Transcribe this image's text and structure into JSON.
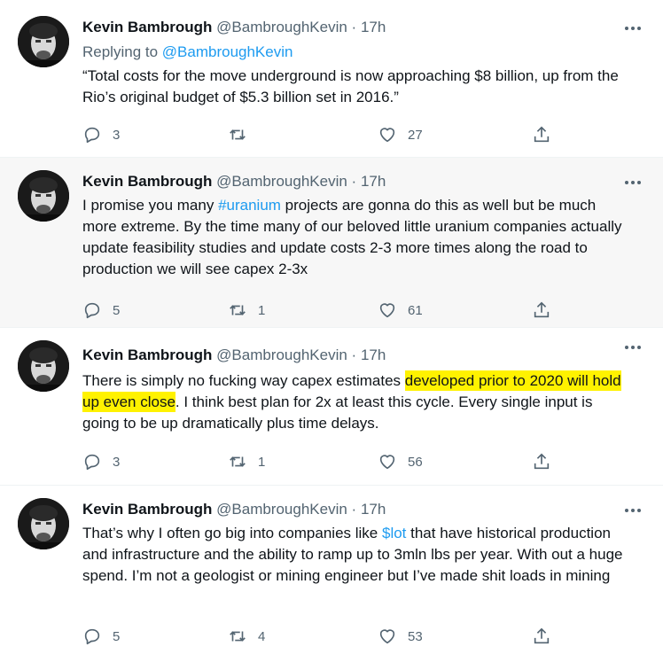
{
  "tweets": [
    {
      "name": "Kevin Bambrough",
      "handle": "@BambroughKevin",
      "separator": "·",
      "time": "17h",
      "replying_prefix": "Replying to ",
      "replying_to": "@BambroughKevin",
      "text": "“Total costs for the move underground is now approaching $8 billion, up from the Rio’s original budget of $5.3 billion set in 2016.”",
      "replies": "3",
      "retweets": "",
      "likes": "27"
    },
    {
      "name": "Kevin Bambrough",
      "handle": "@BambroughKevin",
      "separator": "·",
      "time": "17h",
      "text_before": "I promise you many ",
      "hashtag": "#uranium",
      "text_after": " projects are gonna do this as well but be much more extreme.  By the time many of our beloved little uranium companies actually update feasibility studies and update costs 2-3 more times along the road to production we will see capex 2-3x",
      "replies": "5",
      "retweets": "1",
      "likes": "61"
    },
    {
      "name": "Kevin Bambrough",
      "handle": "@BambroughKevin",
      "separator": "·",
      "time": "17h",
      "text_before": "There is simply no fucking way capex estimates ",
      "highlight": "developed prior to 2020 will hold up even close",
      "text_after": ". I think best plan for 2x at least this cycle.  Every single input is going to be up dramatically plus time delays.",
      "replies": "3",
      "retweets": "1",
      "likes": "56"
    },
    {
      "name": "Kevin Bambrough",
      "handle": "@BambroughKevin",
      "separator": "·",
      "time": "17h",
      "text_before": "That’s why I often go big into companies like ",
      "cashtag": "$lot",
      "text_after": " that have historical production and infrastructure and the ability to ramp up to 3mln lbs per year. With out a huge spend. I’m not a geologist or mining engineer but I’ve made shit loads in mining",
      "replies": "5",
      "retweets": "4",
      "likes": "53"
    }
  ],
  "icons": {
    "avatar": "avatar",
    "more": "more-icon",
    "reply": "reply-icon",
    "retweet": "retweet-icon",
    "like": "like-icon",
    "share": "share-icon"
  },
  "colors": {
    "link": "#1d9bf0",
    "secondary_text": "#536471",
    "highlight": "#fff200",
    "shaded_background": "#f7f7f7"
  }
}
